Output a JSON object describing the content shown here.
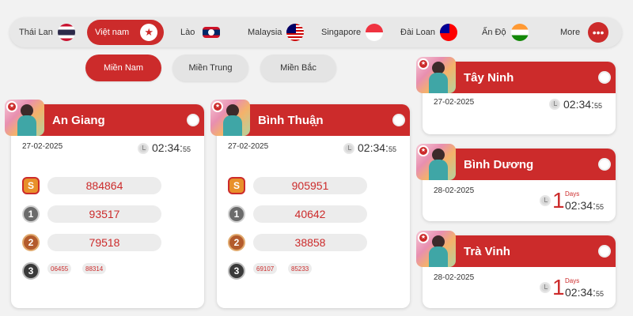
{
  "countries": [
    {
      "label": "Thái Lan",
      "flag": "thailand-flag-icon"
    },
    {
      "label": "Việt nam",
      "flag": "vietnam-flag-icon",
      "active": true
    },
    {
      "label": "Lào",
      "flag": "laos-flag-icon"
    },
    {
      "label": "Malaysia",
      "flag": "malaysia-flag-icon"
    },
    {
      "label": "Singapore",
      "flag": "singapore-flag-icon"
    },
    {
      "label": "Đài Loan",
      "flag": "taiwan-flag-icon"
    },
    {
      "label": "Ấn Độ",
      "flag": "india-flag-icon"
    },
    {
      "label": "More",
      "icon": "more-dots-icon",
      "glyph": "•••"
    }
  ],
  "regions": [
    {
      "label": "Miền Nam",
      "active": true
    },
    {
      "label": "Miền Trung"
    },
    {
      "label": "Miền Bắc"
    }
  ],
  "colors": {
    "accent": "#cc2b2b",
    "background": "#f2f2f2",
    "pill": "#ececec"
  },
  "provinces": [
    {
      "name": "An Giang",
      "date": "27-02-2025",
      "time": "02:34:",
      "seconds": "55",
      "prizes": {
        "special": "884864",
        "first": "93517",
        "second": "79518",
        "third": [
          "06455",
          "88314"
        ]
      },
      "prize_labels": {
        "special": "S",
        "first": "1",
        "second": "2",
        "third": "3"
      }
    },
    {
      "name": "Bình Thuậ̣n",
      "date": "27-02-2025",
      "time": "02:34:",
      "seconds": "55",
      "prizes": {
        "special": "905951",
        "first": "40642",
        "second": "38858",
        "third": [
          "69107",
          "85233"
        ]
      },
      "prize_labels": {
        "special": "S",
        "first": "1",
        "second": "2",
        "third": "3"
      }
    },
    {
      "name": "Tây Ninh",
      "date": "27-02-2025",
      "time": "02:34:",
      "seconds": "55"
    },
    {
      "name": "Bình Dương",
      "date": "28-02-2025",
      "days": "1",
      "days_label": "Days",
      "time": "02:34:",
      "seconds": "55"
    },
    {
      "name": "Trà Vinh",
      "date": "28-02-2025",
      "days": "1",
      "days_label": "Days",
      "time": "02:34:",
      "seconds": "55"
    }
  ],
  "icons": {
    "badge": "star-badge-icon",
    "badge_glyph": "★",
    "toggle": "toggle-icon",
    "clock": "clock-icon"
  }
}
